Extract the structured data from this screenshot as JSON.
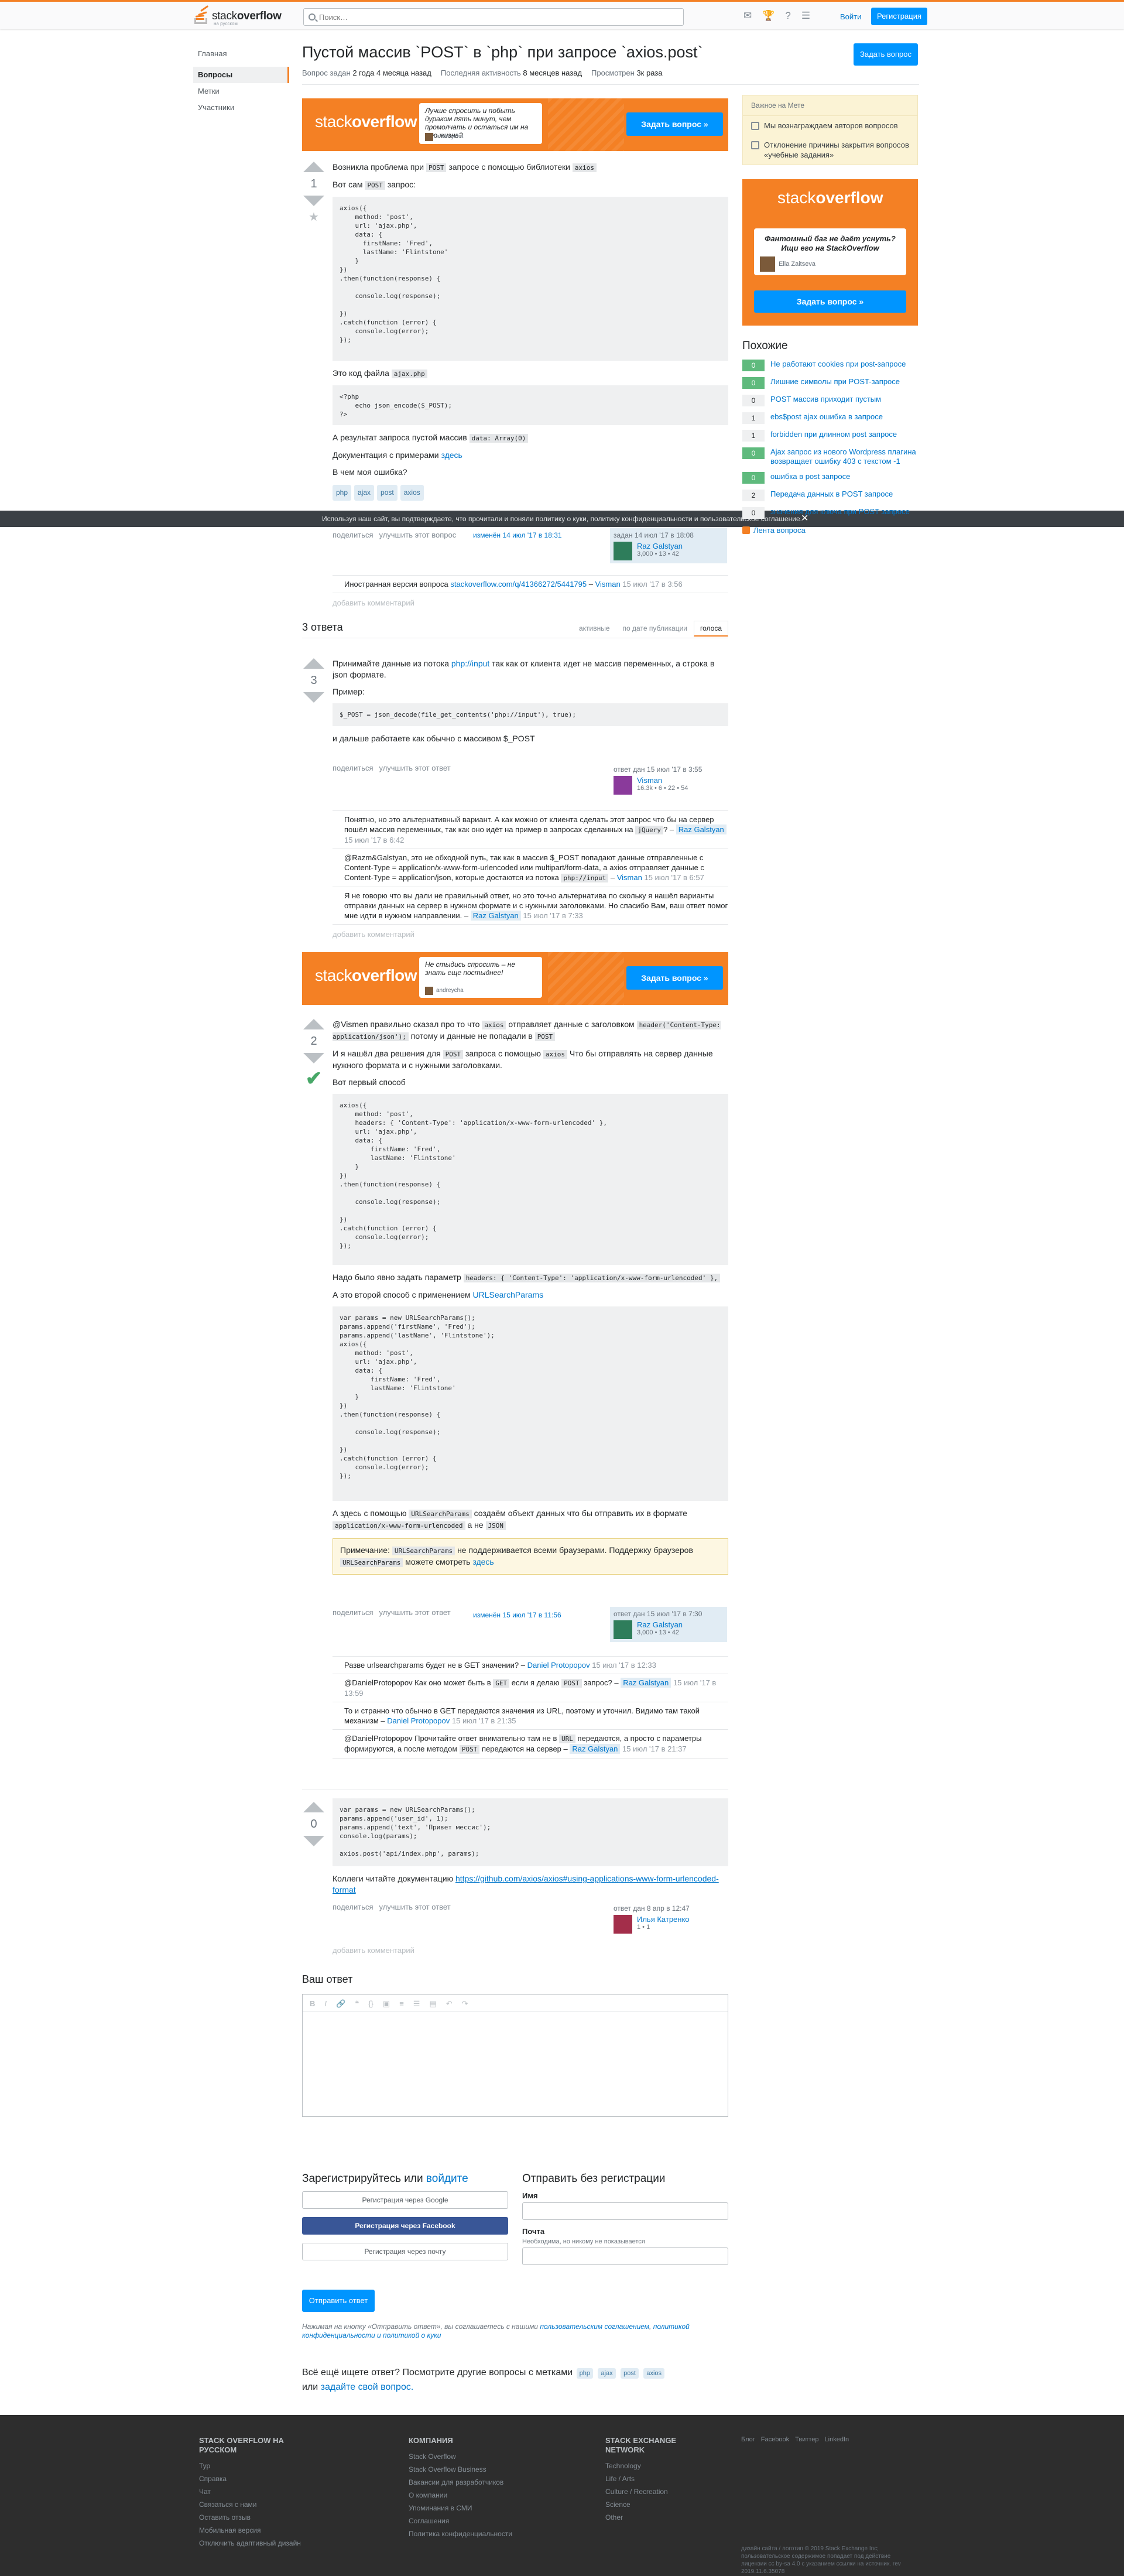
{
  "header": {
    "logo_text_light": "stack",
    "logo_text_bold": "overflow",
    "logo_sub": "на русском",
    "search_placeholder": "Поиск…",
    "login": "Войти",
    "signup": "Регистрация"
  },
  "nav": {
    "items": [
      {
        "label": "Главная"
      },
      {
        "label": "Вопросы"
      },
      {
        "label": "Метки"
      },
      {
        "label": "Участники"
      }
    ]
  },
  "question": {
    "title": "Пустой массив `POST` в `php` при запросе `axios.post`",
    "ask_button": "Задать вопрос",
    "asked_label": "Вопрос задан",
    "asked_value": "2 года 4 месяца назад",
    "active_label": "Последняя активность",
    "active_value": "8 месяцев назад",
    "views_label": "Просмотрен",
    "views_value": "3к раза",
    "votes": "1",
    "p1_a": "Возникла проблема при",
    "p1_code1": "POST",
    "p1_b": "запросе с помощью библиотеки",
    "p1_code2": "axios",
    "p2_a": "Вот сам",
    "p2_code": "POST",
    "p2_b": "запрос:",
    "code1": "axios({\n    method: 'post',\n    url: 'ajax.php',\n    data: {\n      firstName: 'Fred',\n      lastName: 'Flintstone'\n    }\n})\n.then(function(response) {\n\n    console.log(response);\n\n})\n.catch(function (error) {\n    console.log(error);\n});",
    "p3_a": "Это код файла",
    "p3_code": "ajax.php",
    "code2": "<?php\n    echo json_encode($_POST);\n?>",
    "p4_a": "А результат запроса пустой массив",
    "p4_code": "data: Array(0)",
    "p5_a": "Документация с примерами",
    "p5_link": "здесь",
    "p6": "В чем моя ошибка?",
    "tags": [
      "php",
      "ajax",
      "post",
      "axios"
    ],
    "menu_share": "поделиться",
    "menu_improve": "улучшить этот вопрос",
    "edited": "изменён 14 июл '17 в 18:31",
    "sig_asked": "задан 14 июл '17 в 18:08",
    "sig_user": "Raz Galstyan",
    "sig_rep": "3,000 • 13 • 42",
    "comment_text": "Иностранная версия вопроса",
    "comment_link": "stackoverflow.com/q/41366272/5441795",
    "comment_author": "Visman",
    "comment_date": "15 июл '17 в 3:56",
    "add_comment": "добавить комментарий"
  },
  "cookie": {
    "text": "Используя наш сайт, вы подтверждаете, что прочитали и поняли политику о куки, политику конфиденциальности и пользовательское соглашение."
  },
  "answers_header": {
    "count": "3 ответа",
    "tab_active": "активные",
    "tab_oldest": "по дате публикации",
    "tab_votes": "голоса"
  },
  "answer1": {
    "votes": "3",
    "p1_a": "Принимайте данные из потока",
    "p1_link": "php://input",
    "p1_b": "так как от клиента идет не массив переменных, а строка в json формате.",
    "p2": "Пример:",
    "code": "$_POST = json_decode(file_get_contents('php://input'), true);",
    "p3": "и дальше работаете как обычно с массивом $_POST",
    "sig_answered": "ответ дан 15 июл '17 в 3:55",
    "sig_user": "Visman",
    "sig_rep": "16.3k • 6 • 22 • 54",
    "c1": "Понятно, но это альтернативный вариант. А как можно от клиента сделать этот запрос что бы на сервер пошёл массив переменных, так как оно идёт на пример в запросах сделанных на",
    "c1_code": "jQuery",
    "c1_author": "Raz Galstyan",
    "c1_date": "15 июл '17 в 6:42",
    "c2": "@Razm&Galstyan, это не обходной путь, так как в массив $_POST попадают данные отправленные с Content-Type = application/x-www-form-urlencoded или multipart/form-data, а axios отправляет данные с Content-Type = application/json, которые достаются из потока",
    "c2_code": "php://input",
    "c2_author": "Visman",
    "c2_date": "15 июл '17 в 6:57",
    "c3": "Я не говорю что вы дали не правильный ответ, но это точно альтернатива по скольку я нашёл варианты отправки данных на сервер в нужном формате и с нужными заголовками. Но спасибо Вам, ваш ответ помог мне идти в нужном направлении.",
    "c3_author": "Raz Galstyan",
    "c3_date": "15 июл '17 в 7:33",
    "add_comment": "добавить комментарий"
  },
  "ad1": {
    "text": "Лучше спросить и побыть дураком пять минут, чем промолчать и остаться им на всю жизнь?",
    "who": "andreycha",
    "cta": "Задать вопрос »"
  },
  "ad2": {
    "text": "Не стыдись спросить – не знать еще постыднее!",
    "who": "andreycha",
    "cta": "Задать вопрос »"
  },
  "answer2": {
    "votes": "2",
    "p1_a": "@Vismen правильно сказал про то что",
    "p1_code": "axios",
    "p1_b": "отправляет данные с заголовком",
    "p1_code2": "header('Content-Type: application/json');",
    "p1_c": "потому и данные не попадали в",
    "p1_code3": "POST",
    "p2_a": "И я нашёл два решения для",
    "p2_code": "POST",
    "p2_b": "запроса с помощью",
    "p2_code2": "axios",
    "p2_c": "Что бы отправлять на сервер данные нужного формата и с нужными заголовками.",
    "p3": "Вот первый способ",
    "code1": "axios({\n    method: 'post',\n    headers: { 'Content-Type': 'application/x-www-form-urlencoded' },\n    url: 'ajax.php',\n    data: {\n        firstName: 'Fred',\n        lastName: 'Flintstone'\n    }\n})\n.then(function(response) {\n\n    console.log(response);\n\n})\n.catch(function (error) {\n    console.log(error);\n});",
    "p4_a": "Надо было явно задать параметр",
    "p4_code": "headers: { 'Content-Type': 'application/x-www-form-urlencoded' },",
    "p5_a": "А это второй способ с применением",
    "p5_link": "URLSearchParams",
    "code2": "var params = new URLSearchParams();\nparams.append('firstName', 'Fred');\nparams.append('lastName', 'Flintstone');\naxios({\n    method: 'post',\n    url: 'ajax.php',\n    data: {\n        firstName: 'Fred',\n        lastName: 'Flintstone'\n    }\n})\n.then(function(response) {\n\n    console.log(response);\n\n})\n.catch(function (error) {\n    console.log(error);\n});",
    "p6_a": "А здесь с помощью",
    "p6_code": "URLSearchParams",
    "p6_b": "создаём объект данных что бы отправить их в формате",
    "p6_code2": "application/x-www-form-urlencoded",
    "p6_c": "а не",
    "p6_code3": "JSON",
    "note_a": "Примечание:",
    "note_code": "URLSearchParams",
    "note_b": "не поддерживается всеми браузерами. Поддержку браузеров",
    "note_code2": "URLSearchParams",
    "note_c": "можете смотреть",
    "note_link": "здесь",
    "edited": "изменён 15 июл '17 в 11:56",
    "sig_answered": "ответ дан 15 июл '17 в 7:30",
    "sig_user": "Raz Galstyan",
    "sig_rep": "3,000 • 13 • 42",
    "c1": "Разве urlsearchparams будет не в GET значении?",
    "c1_author": "Daniel Protopopov",
    "c1_date": "15 июл '17 в 12:33",
    "c2_a": "@DanielProtopopov Как оно может быть в",
    "c2_code": "GET",
    "c2_b": "если я делаю",
    "c2_code2": "POST",
    "c2_c": "запрос?",
    "c2_author": "Raz Galstyan",
    "c2_date": "15 июл '17 в 13:59",
    "c3": "То и странно что обычно в GET передаются значения из URL, поэтому и уточнил. Видимо там такой механизм",
    "c3_author": "Daniel Protopopov",
    "c3_date": "15 июл '17 в 21:35",
    "c4_a": "@DanielProtopopov Прочитайте ответ внимательно там не в",
    "c4_code": "URL",
    "c4_b": "передаются, а просто с параметры формируются, а после методом",
    "c4_code2": "POST",
    "c4_c": "передаются на сервер",
    "c4_author": "Raz Galstyan",
    "c4_date": "15 июл '17 в 21:37",
    "add_comment": "добавить комментарий"
  },
  "answer3": {
    "votes": "0",
    "code": "var params = new URLSearchParams();\nparams.append('user_id', 1);\nparams.append('text', 'Привет мессис');\nconsole.log(params);\n\naxios.post('api/index.php', params);",
    "p1_a": "Коллеги читайте документацию",
    "p1_link": "https://github.com/axios/axios#using-applications-www-form-urlencoded-format",
    "sig_answered": "ответ дан 8 апр в 12:47",
    "sig_user": "Илья Катренко",
    "sig_rep": "1 • 1",
    "add_comment": "добавить комментарий"
  },
  "post_menu": {
    "share": "поделиться",
    "improve": "улучшить этот ответ"
  },
  "your_answer": {
    "title": "Ваш ответ",
    "signup_title": "Зарегистрируйтесь или",
    "signup_login": "войдите",
    "google": "Регистрация через Google",
    "facebook": "Регистрация через Facebook",
    "email": "Регистрация через почту",
    "guest_title": "Отправить без регистрации",
    "name_label": "Имя",
    "email_label": "Почта",
    "email_hint": "Необходима, но никому не показывается",
    "post_button": "Отправить ответ",
    "tos_a": "Нажимая на кнопку «Отправить ответ», вы соглашаетесь с нашими",
    "tos_link1": "пользовательским соглашением",
    "tos_link2": "политикой конфиденциальности и политикой о куки",
    "browse_a": "Всё ещё ищете ответ? Посмотрите другие вопросы с метками",
    "browse_b": "или",
    "browse_link": "задайте свой вопрос."
  },
  "sidebar": {
    "blog_header": "Важное на Мете",
    "blog_items": [
      "Мы вознаграждаем авторов вопросов",
      "Отклонение причины закрытия вопросов «учебные задания»"
    ],
    "ad_text": "Фантомный баг не даёт уснуть? Ищи его на StackOverflow",
    "ad_who": "Ella Zaitseva",
    "ad_cta": "Задать вопрос »",
    "related_title": "Похожие",
    "related": [
      {
        "score": "0",
        "accepted": true,
        "title": "Не работают cookies при post-запросе"
      },
      {
        "score": "0",
        "accepted": true,
        "title": "Лишние символы при POST-запросе"
      },
      {
        "score": "0",
        "accepted": false,
        "title": "POST массив приходит пустым"
      },
      {
        "score": "1",
        "accepted": false,
        "title": "ebs$post ajax ошибка в запросе"
      },
      {
        "score": "1",
        "accepted": false,
        "title": "forbidden при длинном post запросе"
      },
      {
        "score": "0",
        "accepted": true,
        "title": "Ajax запрос из нового Wordpress плагина возвращает ошибку 403 с текстом -1"
      },
      {
        "score": "0",
        "accepted": true,
        "title": "ошибка в post запросе"
      },
      {
        "score": "2",
        "accepted": false,
        "title": "Передача данных в POST запросе"
      },
      {
        "score": "0",
        "accepted": false,
        "title": "значения для ключа при POST запросе"
      }
    ],
    "feed": "Лента вопроса"
  },
  "footer": {
    "col1_title": "STACK OVERFLOW НА РУССКОМ",
    "col1": [
      "Тур",
      "Справка",
      "Чат",
      "Связаться с нами",
      "Оставить отзыв",
      "Мобильная версия",
      "Отключить адаптивный дизайн"
    ],
    "col2_title": "КОМПАНИЯ",
    "col2": [
      "Stack Overflow",
      "Stack Overflow Business",
      "Вакансии для разработчиков",
      "О компании",
      "Упоминания в СМИ",
      "Соглашения",
      "Политика конфиденциальности"
    ],
    "col3_title": "STACK EXCHANGE NETWORK",
    "col3": [
      "Technology",
      "Life / Arts",
      "Culture / Recreation",
      "Science",
      "Other"
    ],
    "social": [
      "Блог",
      "Facebook",
      "Твиттер",
      "LinkedIn"
    ],
    "copyright": "дизайн сайта / логотип © 2019 Stack Exchange Inc; пользовательское содержимое попадает под действие лицензии cc by-sa 4.0 с указанием ссылки на источник. rev 2019.11.6.35078"
  }
}
